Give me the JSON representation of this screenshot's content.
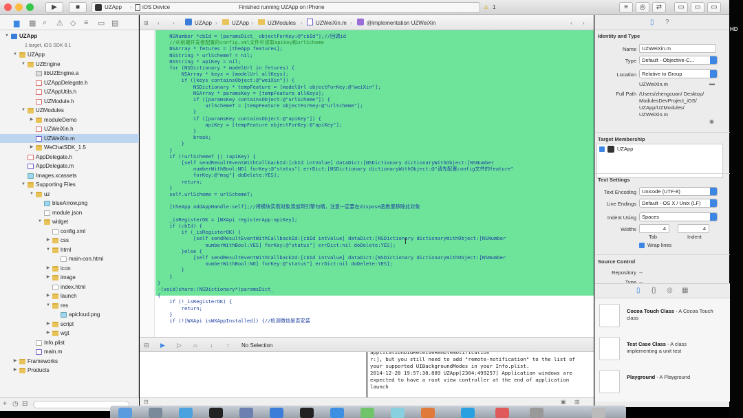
{
  "toolbar": {
    "scheme_app": "UZApp",
    "scheme_device": "iOS Device",
    "status": "Finished running UZApp on iPhone",
    "warning_count": "1"
  },
  "side_label": "HD",
  "navigator": {
    "items": [
      {
        "label": "UZApp",
        "depth": 0,
        "icon": "proj",
        "open": true,
        "bold": true
      },
      {
        "label": "1 target, iOS SDK 8.1",
        "depth": 0,
        "icon": "none",
        "sub": true
      },
      {
        "label": "UZApp",
        "depth": 1,
        "icon": "folder",
        "open": true
      },
      {
        "label": "UZEngine",
        "depth": 2,
        "icon": "folder",
        "open": true
      },
      {
        "label": "libUZEngine.a",
        "depth": 3,
        "icon": "lib"
      },
      {
        "label": "UZAppDelegate.h",
        "depth": 3,
        "icon": "h"
      },
      {
        "label": "UZAppUtils.h",
        "depth": 3,
        "icon": "h"
      },
      {
        "label": "UZModule.h",
        "depth": 3,
        "icon": "h"
      },
      {
        "label": "UZModules",
        "depth": 2,
        "icon": "folder",
        "open": true
      },
      {
        "label": "moduleDemo",
        "depth": 3,
        "icon": "folder",
        "open": false
      },
      {
        "label": "UZWeiXin.h",
        "depth": 3,
        "icon": "h"
      },
      {
        "label": "UZWeiXin.m",
        "depth": 3,
        "icon": "m",
        "selected": true
      },
      {
        "label": "WeChatSDK_1.5",
        "depth": 3,
        "icon": "folder",
        "open": false
      },
      {
        "label": "AppDelegate.h",
        "depth": 2,
        "icon": "h"
      },
      {
        "label": "AppDelegate.m",
        "depth": 2,
        "icon": "m"
      },
      {
        "label": "Images.xcassets",
        "depth": 2,
        "icon": "img"
      },
      {
        "label": "Supporting Files",
        "depth": 2,
        "icon": "folder",
        "open": true
      },
      {
        "label": "uz",
        "depth": 3,
        "icon": "folder",
        "open": true
      },
      {
        "label": "blueArrow.png",
        "depth": 4,
        "icon": "img"
      },
      {
        "label": "module.json",
        "depth": 4,
        "icon": "file"
      },
      {
        "label": "widget",
        "depth": 4,
        "icon": "folder",
        "open": true
      },
      {
        "label": "config.xml",
        "depth": 5,
        "icon": "file"
      },
      {
        "label": "css",
        "depth": 5,
        "icon": "folder",
        "open": false
      },
      {
        "label": "html",
        "depth": 5,
        "icon": "folder",
        "open": true
      },
      {
        "label": "main-con.html",
        "depth": 6,
        "icon": "file"
      },
      {
        "label": "icon",
        "depth": 5,
        "icon": "folder",
        "open": false
      },
      {
        "label": "image",
        "depth": 5,
        "icon": "folder",
        "open": false
      },
      {
        "label": "index.html",
        "depth": 5,
        "icon": "file"
      },
      {
        "label": "launch",
        "depth": 5,
        "icon": "folder",
        "open": false
      },
      {
        "label": "res",
        "depth": 5,
        "icon": "folder",
        "open": true
      },
      {
        "label": "apicloud.png",
        "depth": 6,
        "icon": "img"
      },
      {
        "label": "script",
        "depth": 5,
        "icon": "folder",
        "open": false
      },
      {
        "label": "wgt",
        "depth": 5,
        "icon": "folder",
        "open": false
      },
      {
        "label": "Info.plist",
        "depth": 3,
        "icon": "file"
      },
      {
        "label": "main.m",
        "depth": 3,
        "icon": "m"
      },
      {
        "label": "Frameworks",
        "depth": 1,
        "icon": "folder",
        "open": false
      },
      {
        "label": "Products",
        "depth": 1,
        "icon": "folder",
        "open": false
      }
    ]
  },
  "jumpbar": {
    "crumbs": [
      "UZApp",
      "UZApp",
      "UZModules",
      "UZWeiXin.m",
      "@implementation UZWeiXin"
    ]
  },
  "editor": {
    "line_numbers": [
      "",
      "",
      "",
      "",
      "",
      "",
      "",
      "",
      "",
      "",
      "",
      "",
      "",
      "",
      "",
      "",
      "",
      "",
      "",
      "",
      "",
      "",
      "",
      "",
      "",
      "",
      "",
      "",
      "",
      "",
      "",
      "",
      "",
      "",
      "",
      "",
      "",
      "",
      "",
      "",
      "",
      "",
      "",
      "",
      "",
      "",
      "",
      "",
      ""
    ],
    "lines": [
      "    NSNumber *cbId = [paramsDict_ objectForKey:@\"cbId\"];//回调id",
      "    //从前端开发者配置的config.xml文件中读取apikey和urlScheme",
      "    NSArray * fetures = [theApp features];",
      "    NSString * urlSchemeT = nil;",
      "    NSString * apiKey = nil;",
      "    for (NSDictionary * modelUrl in fetures) {",
      "        NSArray * keys = [modelUrl allKeys];",
      "        if ([keys containsObject:@\"weiXin\"]) {",
      "            NSDictionary * tempFeature = [modelUrl objectForKey:@\"weiXin\"];",
      "            NSArray * paramsKey = [tempFeature allKeys];",
      "            if ([paramsKey containsObject:@\"urlScheme\"]) {",
      "                urlSchemeT = [tempFeature objectForKey:@\"urlScheme\"];",
      "            }",
      "            if ([paramsKey containsObject:@\"apiKey\"]) {",
      "                apiKey = [tempFeature objectForKey:@\"apiKey\"];",
      "            }",
      "            break;",
      "        }",
      "    }",
      "    if (!urlSchemeT || !apiKey) {",
      "        [self sendResultEventWithCallbackId:[cbId intValue] dataDict:[NSDictionary dictionaryWithObject:[NSNumber",
      "            numberWithBool:NO] forKey:@\"status\"] errDict:[NSDictionary dictionaryWithObject:@\"请先配置config文件的feature\"",
      "            forKey:@\"msg\"] doDelete:YES];",
      "        return;",
      "    }",
      "    self.urlScheme = urlSchemeT;",
      "",
      "    [theApp addAppHandle:self];//将模块实例对象添加到引擎句柄，注意一定要在dispose函数里移除此对象",
      "",
      "    _isRegisterOK = [WXApi registerApp:apiKey];",
      "    if (cbId) {",
      "        if (_isRegisterOK) {",
      "            [self sendResultEventWithCallbackId:[cbId intValue] dataDict:[NSDictionary dictionaryWithObject:[NSNumber",
      "                numberWithBool:YES] forKey:@\"status\"] errDict:nil doDelete:YES];",
      "        }else {",
      "            [self sendResultEventWithCallbackId:[cbId intValue] dataDict:[NSDictionary dictionaryWithObject:[NSNumber",
      "                numberWithBool:NO] forKey:@\"status\"] errDict:nil doDelete:YES];",
      "        }",
      "    }",
      "}",
      "-(void)share:(NSDictionary*)paramsDict_",
      "{",
      "    if (!_isRegisterOK) {",
      "        return;",
      "    }",
      "    if (![WXApi isWXAppInstalled]) {//检测微信是否安装"
    ]
  },
  "debug": {
    "selection": "No Selection"
  },
  "console": {
    "text": "applicationDidReceiveRemoteNotification\nr:], but you still need to add \"remote-notification\" to the list of your supported UIBackgroundModes in your Info.plist.\n2014-12-28 19:57:38.889 UZApp[2304:499257] Application windows are expected to have a root view controller at the end of application launch"
  },
  "inspector": {
    "identity_header": "Identity and Type",
    "name_label": "Name",
    "name_value": "UZWeiXin.m",
    "type_label": "Type",
    "type_value": "Default - Objective-C...",
    "location_label": "Location",
    "location_value": "Relative to Group",
    "location_file": "UZWeiXin.m",
    "fullpath_label": "Full Path",
    "fullpath_value": "/Users/zhengcuan/ Desktop/ ModulesDevProject_iOS/ UZApp/UZModules/ UZWeiXin.m",
    "target_header": "Target Membership",
    "target_item": "UZApp",
    "text_header": "Text Settings",
    "encoding_label": "Text Encoding",
    "encoding_value": "Unicode (UTF-8)",
    "endings_label": "Line Endings",
    "endings_value": "Default - OS X / Unix (LF)",
    "indent_label": "Indent Using",
    "indent_value": "Spaces",
    "widths_label": "Widths",
    "tab_width": "4",
    "indent_width": "4",
    "tab_label": "Tab",
    "indent_sub_label": "Indent",
    "wrap_label": "Wrap lines",
    "source_header": "Source Control",
    "repository_label": "Repository",
    "repository_value": "--",
    "type2_label": "Type",
    "type2_value": "--"
  },
  "library": {
    "items": [
      {
        "title": "Cocoa Touch Class",
        "desc": " - A Cocoa Touch class"
      },
      {
        "title": "Test Case Class",
        "desc": " - A class implementing a unit test"
      },
      {
        "title": "Playground",
        "desc": " - A Playground"
      }
    ]
  },
  "colors": {
    "highlight": "#6ee49b",
    "selection": "#bdd5ef",
    "accent": "#3d86e4"
  }
}
